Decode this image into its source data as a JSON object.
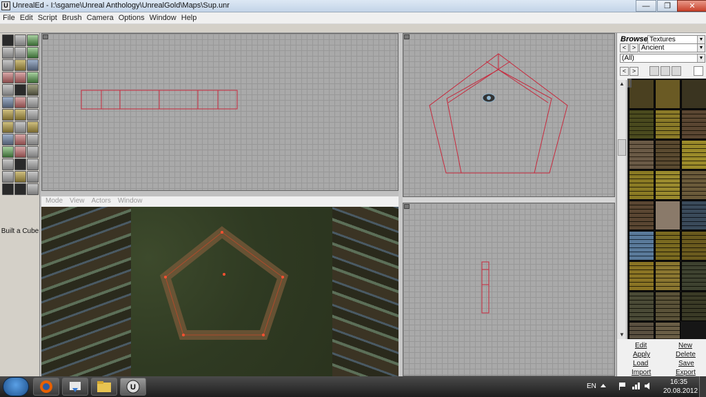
{
  "window": {
    "title": "UnrealEd - I:\\sgame\\Unreal Anthology\\UnrealGold\\Maps\\Sup.unr",
    "icon": "unreal-logo-icon",
    "controls": {
      "minimize": "—",
      "maximize": "❐",
      "close": "✕"
    }
  },
  "menu": [
    "File",
    "Edit",
    "Script",
    "Brush",
    "Camera",
    "Options",
    "Window",
    "Help"
  ],
  "palette": {
    "status": "Built a Cube"
  },
  "viewport_menu": [
    "Mode",
    "View",
    "Actors",
    "Window"
  ],
  "browser": {
    "label": "Browse",
    "type": "Textures",
    "package": "Ancient",
    "group": "(All)",
    "nav_prev": "<",
    "nav_next": ">",
    "actions": [
      "Edit",
      "New",
      "Apply",
      "Delete",
      "Load",
      "Save",
      "Import",
      "Export"
    ]
  },
  "taskbar": {
    "apps": [
      "start-orb",
      "firefox",
      "downloads",
      "explorer",
      "unrealed"
    ],
    "lang": "EN",
    "time": "16:35",
    "date": "20.08.2012"
  },
  "colors": {
    "grid": "#a9a9a9",
    "brush": "#c8283c",
    "accent": "#1d4f8a"
  }
}
